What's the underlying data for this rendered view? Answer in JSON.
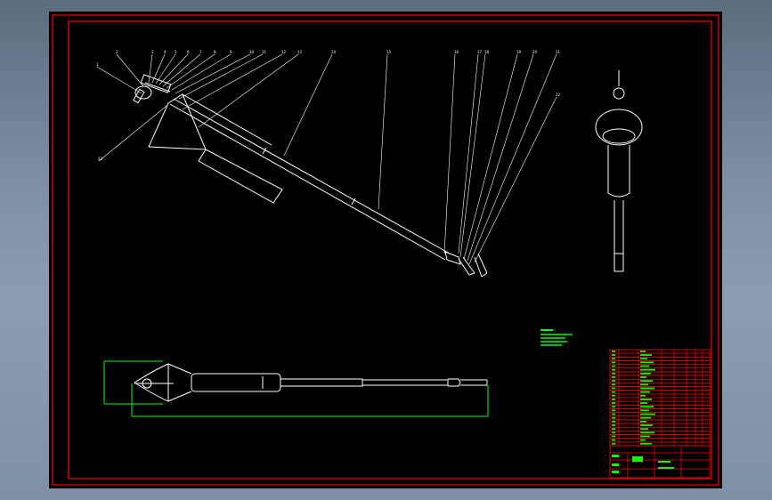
{
  "drawing": {
    "main_view_balloons": [
      "1",
      "2",
      "3",
      "4",
      "5",
      "6",
      "7",
      "8",
      "9",
      "10",
      "11",
      "12",
      "13",
      "14",
      "15",
      "16",
      "17",
      "18",
      "19",
      "20",
      "21",
      "22",
      "23",
      "24",
      "25"
    ],
    "bottom_view_dimension": "",
    "side_view_dimension": "",
    "technical_notes": {
      "heading": "",
      "lines": []
    },
    "colors": {
      "border_red": "#ff0000",
      "geometry": "#ffffff",
      "dimension_green": "#00ff00",
      "note_green": "#00ff00"
    }
  }
}
